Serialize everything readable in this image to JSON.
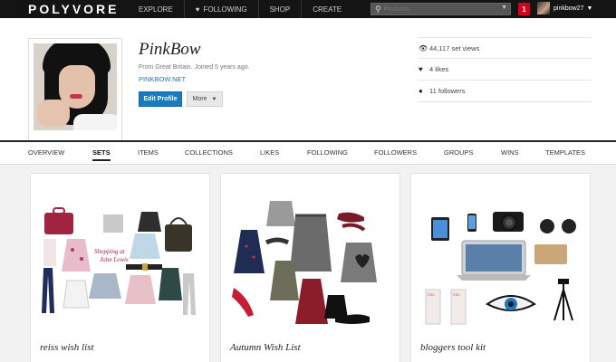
{
  "topbar": {
    "logo": "POLYVORE",
    "nav": [
      "EXPLORE",
      "FOLLOWING",
      "SHOP",
      "CREATE"
    ],
    "search_placeholder": "Products:",
    "notification_count": "1",
    "username": "pinkbow27"
  },
  "profile": {
    "name": "PinkBow",
    "meta": "From Great Britain. Joined 5 years ago.",
    "link": "PINKBOW.NET",
    "edit_label": "Edit Profile",
    "more_label": "More",
    "stats": [
      {
        "icon": "eye-icon",
        "text": "44,117 set views"
      },
      {
        "icon": "heart-icon",
        "text": "4 likes"
      },
      {
        "icon": "person-icon",
        "text": "11 followers"
      }
    ]
  },
  "tabs": [
    "OVERVIEW",
    "SETS",
    "ITEMS",
    "COLLECTIONS",
    "LIKES",
    "FOLLOWING",
    "FOLLOWERS",
    "GROUPS",
    "WINS",
    "TEMPLATES"
  ],
  "active_tab": "SETS",
  "sets": [
    {
      "title": "reiss wish list",
      "caption_line1": "Shopping at",
      "caption_line2": "John Lewis"
    },
    {
      "title": "Autumn Wish List"
    },
    {
      "title": "bloggers tool kit",
      "tag": "lala"
    }
  ],
  "colors": {
    "accent": "#1a7abf",
    "topbar": "#141414",
    "notification": "#d0021b"
  }
}
